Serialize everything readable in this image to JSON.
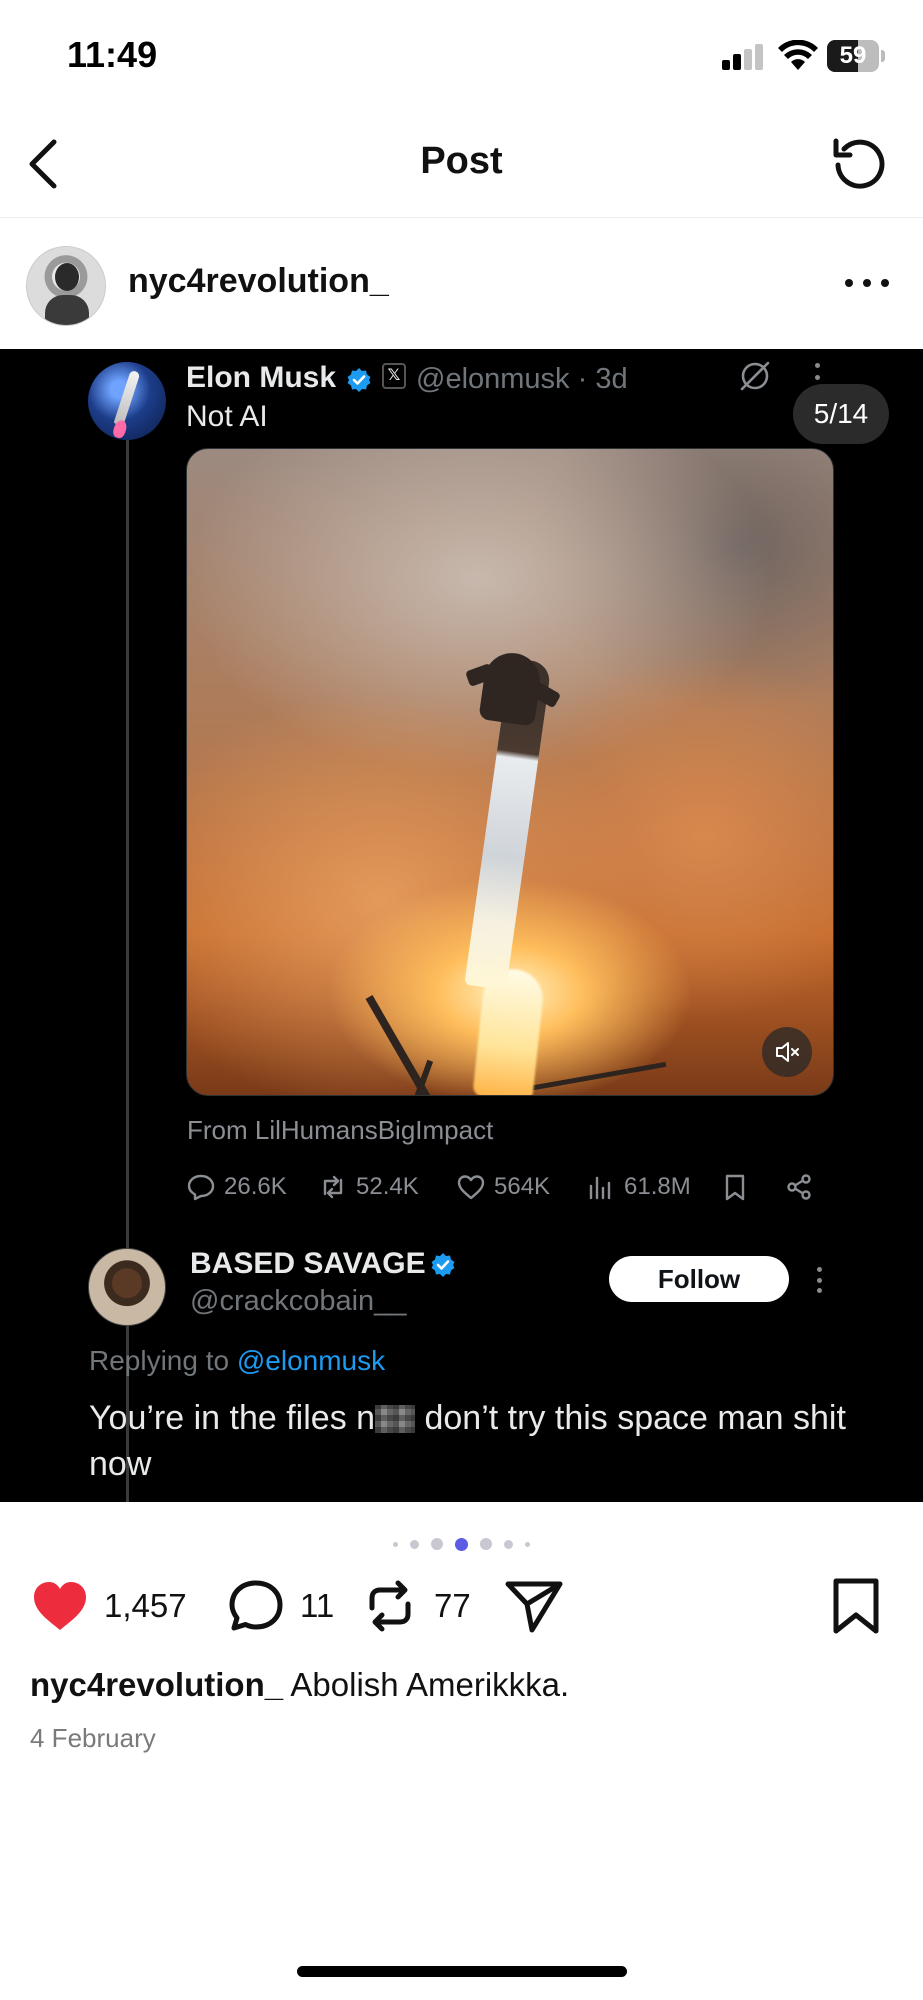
{
  "status_bar": {
    "time": "11:49",
    "battery": "59",
    "battery_level": 0.59
  },
  "header": {
    "title": "Post"
  },
  "post": {
    "author": "nyc4revolution_",
    "caption_user": "nyc4revolution_",
    "caption_text": " Abolish Amerikkka.",
    "date": "4 February",
    "likes": "1,457",
    "comments": "11",
    "reposts": "77",
    "carousel": {
      "current": 3,
      "total_visible_dots": 7
    }
  },
  "tweet": {
    "name": "Elon Musk",
    "x_badge": "𝕏",
    "handle_time": "@elonmusk · 3d",
    "text": "Not AI",
    "counter": "5/14",
    "from": "From LilHumansBigImpact",
    "stats": {
      "replies": "26.6K",
      "reposts": "52.4K",
      "likes": "564K",
      "views": "61.8M"
    }
  },
  "reply": {
    "name": "BASED SAVAGE",
    "handle": "@crackcobain__",
    "follow_label": "Follow",
    "replying_prefix": "Replying to ",
    "replying_mention": "@elonmusk",
    "text_before": "You’re in the files n",
    "text_after": " don’t try this space man shit now"
  },
  "colors": {
    "accent_blue": "#1d9bf0",
    "like_red": "#ed2d3e",
    "dot_active": "#5b5be6"
  },
  "icons": [
    "back-chevron-icon",
    "refresh-icon",
    "more-icon",
    "verified-icon",
    "grok-icon",
    "mute-icon",
    "reply-icon",
    "repost-icon",
    "like-icon",
    "views-icon",
    "bookmark-icon",
    "share-icon",
    "heart-icon",
    "comment-icon",
    "repost-icon",
    "send-icon",
    "save-icon"
  ]
}
